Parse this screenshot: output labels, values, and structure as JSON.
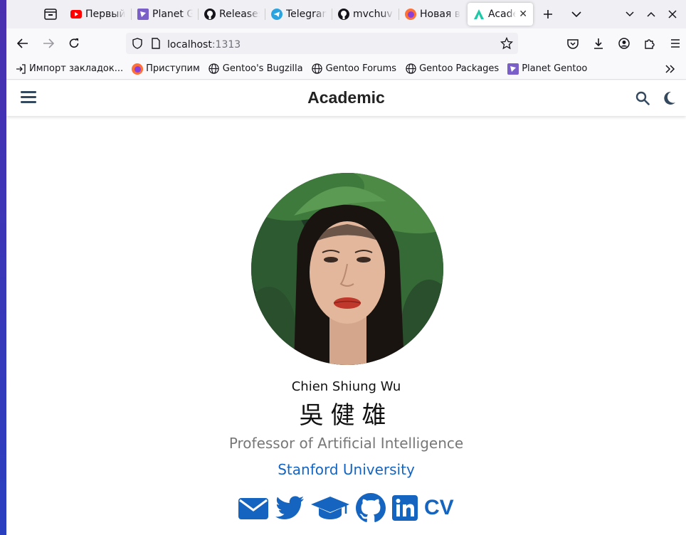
{
  "browser": {
    "tabs": [
      {
        "title": "Первый",
        "icon": "youtube-icon"
      },
      {
        "title": "Planet G",
        "icon": "planet-gentoo-icon"
      },
      {
        "title": "Releases",
        "icon": "github-icon"
      },
      {
        "title": "Telegram",
        "icon": "telegram-icon"
      },
      {
        "title": "mvchuvi",
        "icon": "github-icon"
      },
      {
        "title": "Новая в",
        "icon": "firefox-icon"
      },
      {
        "title": "Acade",
        "icon": "academic-icon",
        "active": true
      }
    ],
    "url_host": "localhost",
    "url_port": ":1313",
    "bookmarks": [
      {
        "label": "Импорт закладок...",
        "icon": "import-icon"
      },
      {
        "label": "Приступим",
        "icon": "firefox-icon"
      },
      {
        "label": "Gentoo's Bugzilla",
        "icon": "globe-icon"
      },
      {
        "label": "Gentoo Forums",
        "icon": "globe-icon"
      },
      {
        "label": "Gentoo Packages",
        "icon": "globe-icon"
      },
      {
        "label": "Planet Gentoo",
        "icon": "planet-gentoo-icon"
      }
    ]
  },
  "site": {
    "title": "Academic",
    "profile": {
      "name": "Chien Shiung Wu",
      "name_cn": "吳健雄",
      "role": "Professor of Artificial Intelligence",
      "organization": "Stanford University",
      "cv_label": "CV"
    },
    "social_icons": [
      "envelope-icon",
      "twitter-icon",
      "graduation-cap-icon",
      "github-icon",
      "linkedin-icon"
    ],
    "accent_color": "#1565c0"
  }
}
